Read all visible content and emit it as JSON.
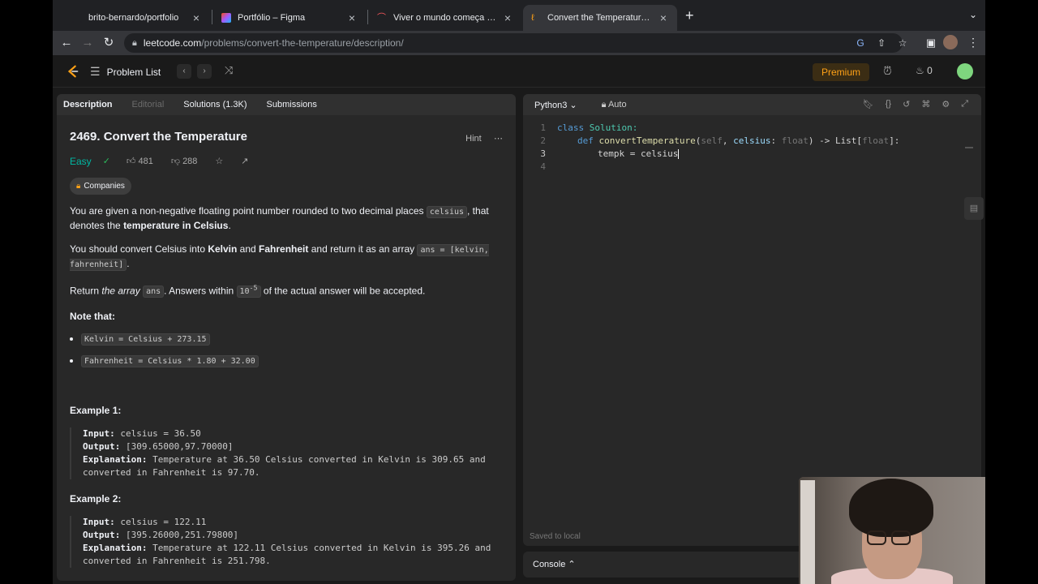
{
  "browser": {
    "tabs": [
      {
        "title": "brito-bernardo/portfolio"
      },
      {
        "title": "Portfólio – Figma"
      },
      {
        "title": "Viver o mundo começa aqui"
      },
      {
        "title": "Convert the Temperature - LeetCode"
      }
    ],
    "url_host": "leetcode.com",
    "url_path": "/problems/convert-the-temperature/description/"
  },
  "nav": {
    "problem_list": "Problem List",
    "premium": "Premium",
    "streak": "0"
  },
  "left": {
    "tabs": {
      "description": "Description",
      "editorial": "Editorial",
      "solutions": "Solutions (1.3K)",
      "submissions": "Submissions"
    },
    "title": "2469. Convert the Temperature",
    "hint": "Hint",
    "difficulty": "Easy",
    "likes": "481",
    "dislikes": "288",
    "companies": "Companies",
    "p1a": "You are given a non-negative floating point number rounded to two decimal places ",
    "p1code": "celsius",
    "p1b": ", that denotes the ",
    "p1bold": "temperature in Celsius",
    "p1c": ".",
    "p2a": "You should convert Celsius into ",
    "p2kelvin": "Kelvin",
    "p2and": " and ",
    "p2fahr": "Fahrenheit",
    "p2b": " and return it as an array ",
    "p2code": "ans = [kelvin, fahrenheit]",
    "p2c": ".",
    "p3a": "Return ",
    "p3em": "the array",
    "p3sp": " ",
    "p3code": "ans",
    "p3b": ". Answers within ",
    "p3code2": "10",
    "p3sup": "-5",
    "p3c": " of the actual answer will be accepted.",
    "note": "Note that:",
    "bullets": [
      "Kelvin = Celsius + 273.15",
      "Fahrenheit = Celsius * 1.80 + 32.00"
    ],
    "ex1": {
      "heading": "Example 1:",
      "input_k": "Input:",
      "input_v": " celsius = 36.50",
      "output_k": "Output:",
      "output_v": " [309.65000,97.70000]",
      "expl_k": "Explanation:",
      "expl_v": " Temperature at 36.50 Celsius converted in Kelvin is 309.65 and converted in Fahrenheit is 97.70."
    },
    "ex2": {
      "heading": "Example 2:",
      "input_k": "Input:",
      "input_v": " celsius = 122.11",
      "output_k": "Output:",
      "output_v": " [395.26000,251.79800]",
      "expl_k": "Explanation:",
      "expl_v": " Temperature at 122.11 Celsius converted in Kelvin is 395.26 and converted in Fahrenheit is 251.798."
    }
  },
  "editor": {
    "language": "Python3",
    "mode": "Auto",
    "line_numbers": [
      "1",
      "2",
      "3",
      "4"
    ],
    "code": {
      "l1_kw": "class",
      "l1_name": " Solution:",
      "l2_kw": "def",
      "l2_fn": " convertTemperature",
      "l2_a": "(",
      "l2_self": "self",
      "l2_b": ", ",
      "l2_celsius": "celsius",
      "l2_c": ": ",
      "l2_float": "float",
      "l2_d": ") -> List[",
      "l2_float2": "float",
      "l2_e": "]:",
      "l3": "tempk = celsius"
    },
    "saved": "Saved to local",
    "console": "Console ⌃"
  },
  "colors": {
    "accent": "#ffa116",
    "easy": "#00b8a3",
    "panel": "#282828"
  }
}
